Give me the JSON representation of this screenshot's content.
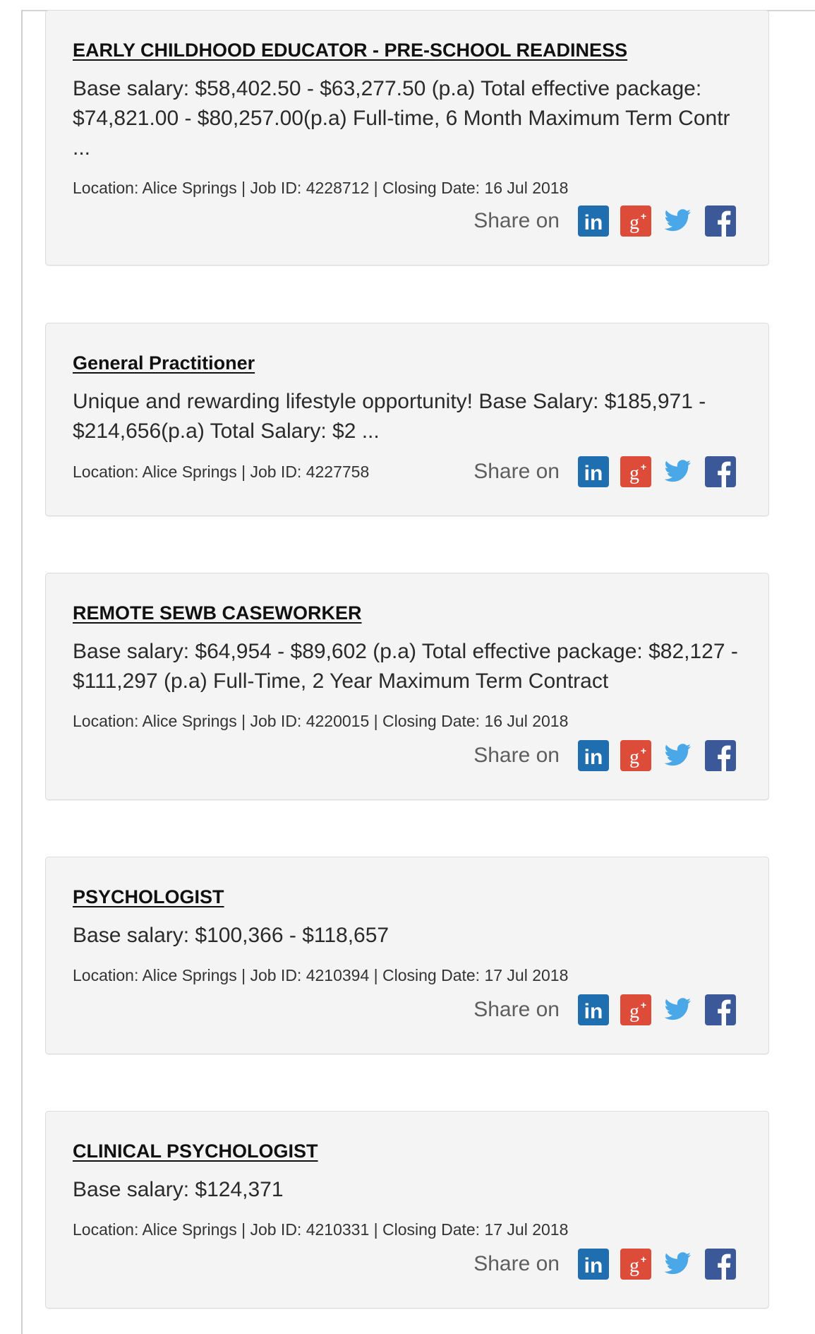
{
  "share_label": "Share on",
  "icons": {
    "linkedin": "linkedin-icon",
    "googleplus": "google-plus-icon",
    "twitter": "twitter-icon",
    "facebook": "facebook-icon"
  },
  "colors": {
    "linkedin": "#1f6fb0",
    "googleplus": "#dd4b39",
    "twitter": "#4aa8e8",
    "facebook": "#3b5998",
    "card_bg": "#f4f4f4"
  },
  "jobs": [
    {
      "title": "EARLY CHILDHOOD EDUCATOR - PRE-SCHOOL READINESS",
      "summary": "Base salary: $58,402.50 - $63,277.50 (p.a)  Total effective package: $74,821.00 - $80,257.00(p.a)  Full-time, 6 Month Maximum Term Contr ...",
      "meta": "Location: Alice Springs | Job ID: 4228712 | Closing Date: 16 Jul 2018"
    },
    {
      "title": "General Practitioner",
      "summary": "Unique and rewarding lifestyle opportunity!  Base Salary: $185,971 - $214,656(p.a)  Total Salary: $2 ...",
      "meta": "Location: Alice Springs | Job ID: 4227758"
    },
    {
      "title": "REMOTE SEWB CASEWORKER",
      "summary": "Base salary: $64,954 - $89,602 (p.a)  Total effective package: $82,127 - $111,297 (p.a)  Full-Time, 2 Year Maximum Term Contract",
      "meta": "Location: Alice Springs | Job ID: 4220015 | Closing Date: 16 Jul 2018"
    },
    {
      "title": "PSYCHOLOGIST",
      "summary": "Base salary: $100,366 - $118,657",
      "meta": "Location: Alice Springs | Job ID: 4210394 | Closing Date: 17 Jul 2018"
    },
    {
      "title": "CLINICAL PSYCHOLOGIST",
      "summary": "Base salary: $124,371",
      "meta": "Location: Alice Springs | Job ID: 4210331 | Closing Date: 17 Jul 2018"
    }
  ]
}
